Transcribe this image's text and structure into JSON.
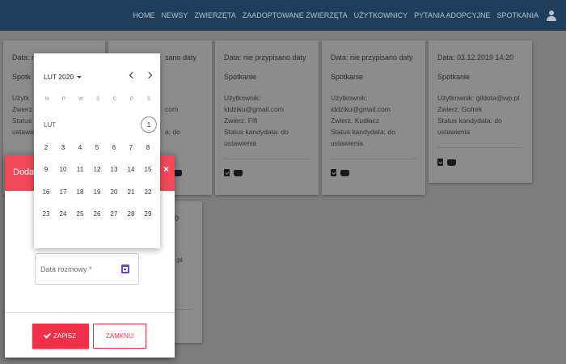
{
  "nav": {
    "links": [
      "HOME",
      "NEWSY",
      "ZWIERZĘTA",
      "ZAADOPTOWANE ZWIERZĘTA",
      "UŻYTKOWNICY",
      "PYTANIA ADOPCYJNE",
      "SPOTKANIA"
    ],
    "user_icon": "user-icon"
  },
  "cards": [
    {
      "date": "Data: nie przypisano daty",
      "title": "Spotkanie",
      "user_label": "Użytkownik:",
      "email": "iddziku@gmail.com",
      "animal": "Zwierz: Fifi",
      "status": "Status kandydata: do",
      "status2": "ustawienia"
    },
    {
      "date": "Data: nie przypisano daty",
      "title": "Spotkanie",
      "user_label": "Użytkownik:",
      "email": "iddziku@gmail.com",
      "animal": "Zwierz: Kudłacz",
      "status": "Status kandydata: do",
      "status2": "ustawienia"
    },
    {
      "date": "Data: 03.12.2019 14:20",
      "title": "Spotkanie",
      "user_label": "Użytkownik: gildota@wp.pl",
      "email": "",
      "animal": "Zwierz: Gofrek",
      "status": "Status kandydata: do",
      "status2": "ustawienia"
    }
  ],
  "partial_cards": {
    "c1_date": "Data: ni",
    "c1_title": "Spotk",
    "c1_user": "Użytk",
    "c1_animal": "Zwierz",
    "c1_status": "Status",
    "c1_status2": "ustawie",
    "c2_date": "sano daty",
    "c2_email": "com",
    "c2_status": "a: do",
    "c3_date": "0",
    "c3_email": "p.pl"
  },
  "dialog": {
    "title": "Dodaj",
    "close": "×",
    "date_placeholder": "Data rozmowy *",
    "save_label": "ZAPISZ",
    "close_label": "ZAMKNIJ"
  },
  "datepicker": {
    "month_label": "LUT 2020",
    "month_short": "LUT",
    "weekdays": [
      "N",
      "P",
      "W",
      "Ś",
      "C",
      "P",
      "S"
    ],
    "days": [
      "1",
      "2",
      "3",
      "4",
      "5",
      "6",
      "7",
      "8",
      "9",
      "10",
      "11",
      "12",
      "13",
      "14",
      "15",
      "16",
      "17",
      "18",
      "19",
      "20",
      "21",
      "22",
      "23",
      "24",
      "25",
      "26",
      "27",
      "28",
      "29"
    ]
  },
  "colors": {
    "nav_bg": "#1f3e5c",
    "accent": "#f04858",
    "icon_purple": "#6f42c1"
  }
}
